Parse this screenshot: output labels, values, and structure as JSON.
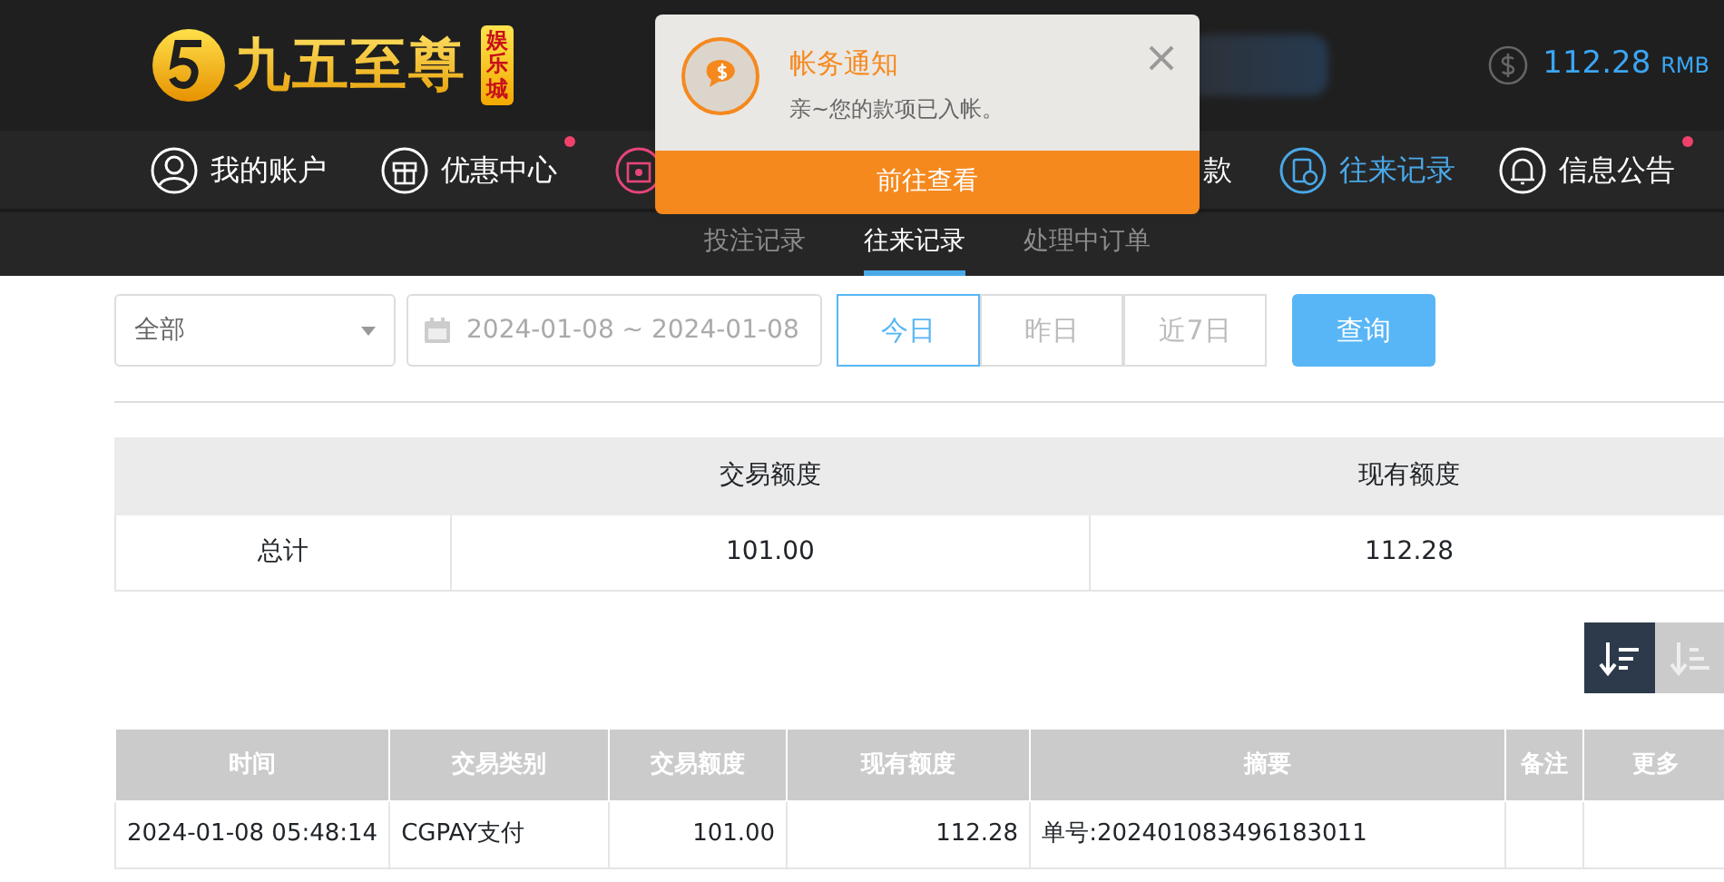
{
  "header": {
    "logo": {
      "title": "九五至尊",
      "badge": "娱乐城"
    },
    "balance": {
      "amount": "112.28",
      "currency": "RMB"
    }
  },
  "nav": [
    {
      "label": "我的账户",
      "selected": false,
      "badge": false
    },
    {
      "label": "优惠中心",
      "selected": false,
      "badge": true
    },
    {
      "selected": false,
      "badge": false
    },
    {
      "label": "款",
      "selected": false,
      "badge": false
    },
    {
      "label": "往来记录",
      "selected": true,
      "badge": false
    },
    {
      "label": "信息公告",
      "selected": false,
      "badge": true
    }
  ],
  "sub_tabs": [
    {
      "label": "投注记录",
      "selected": false
    },
    {
      "label": "往来记录",
      "selected": true
    },
    {
      "label": "处理中订单",
      "selected": false
    }
  ],
  "notification": {
    "title": "帐务通知",
    "message": "亲~您的款项已入帐。",
    "action": "前往查看"
  },
  "filters": {
    "type_select": "全部",
    "date_range": "2024-01-08 ~ 2024-01-08",
    "ranges": [
      {
        "label": "今日",
        "selected": true
      },
      {
        "label": "昨日",
        "selected": false
      },
      {
        "label": "近7日",
        "selected": false
      }
    ],
    "query_button": "查询"
  },
  "summary": {
    "columns": [
      "交易额度",
      "现有额度"
    ],
    "rows": [
      {
        "label": "总计",
        "cells": [
          "101.00",
          "112.28"
        ]
      }
    ]
  },
  "sort_buttons": [
    {
      "kind": "desc",
      "selected": true
    },
    {
      "kind": "asc",
      "selected": false
    }
  ],
  "records": {
    "columns": [
      "时间",
      "交易类别",
      "交易额度",
      "现有额度",
      "摘要",
      "备注",
      "更多"
    ],
    "rows": [
      [
        "2024-01-08 05:48:14",
        "CGPAY支付",
        "101.00",
        "112.28",
        "单号:202401083496183011"
      ]
    ]
  }
}
